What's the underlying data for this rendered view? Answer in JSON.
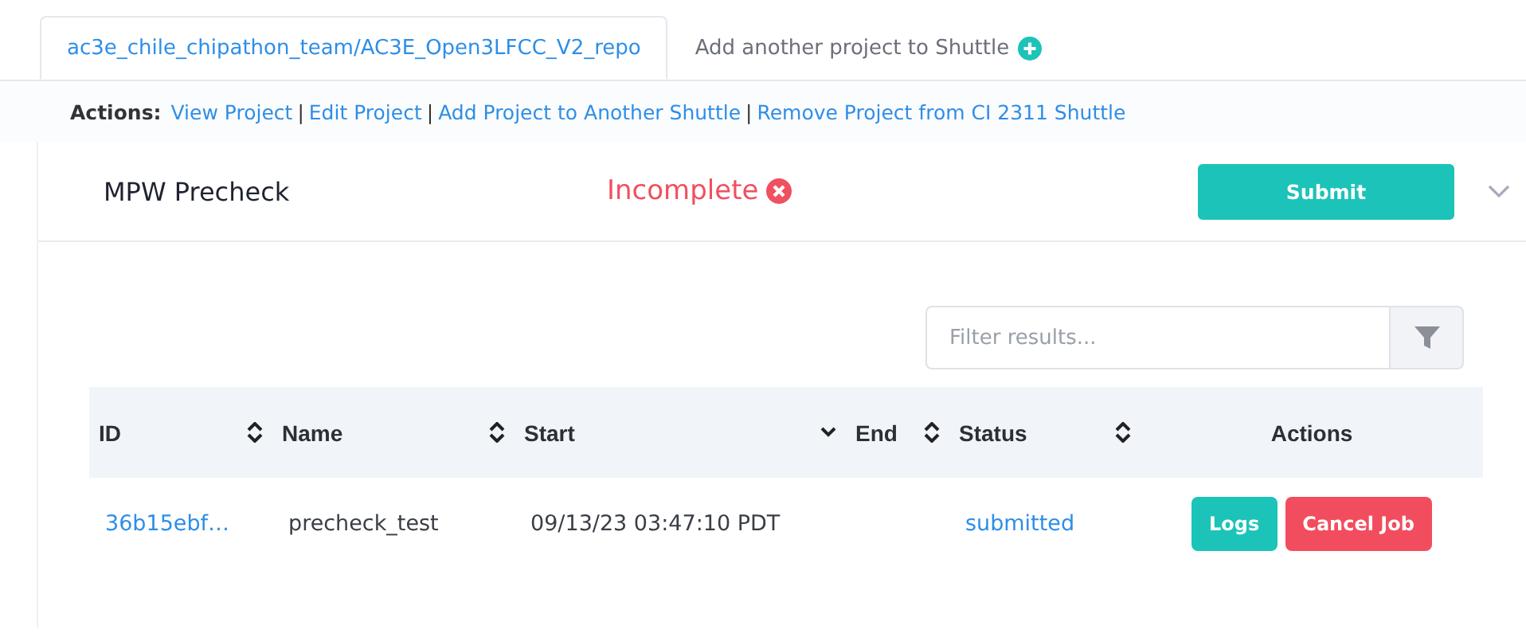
{
  "tabs": [
    {
      "label": "ac3e_chile_chipathon_team/AC3E_Open3LFCC_V2_repo",
      "selected": true,
      "kind": "project"
    },
    {
      "label": "Add another project to Shuttle",
      "selected": false,
      "kind": "add"
    }
  ],
  "actions": {
    "label": "Actions:",
    "separator": "|",
    "links": [
      "View Project",
      "Edit Project",
      "Add Project to Another Shuttle",
      "Remove Project from CI 2311 Shuttle"
    ]
  },
  "precheck": {
    "title": "MPW Precheck",
    "status": "Incomplete",
    "submit": "Submit",
    "expanded": false
  },
  "filter": {
    "placeholder": "Filter results..."
  },
  "table": {
    "columns": [
      {
        "label": "ID",
        "sortable": true,
        "sorted": false
      },
      {
        "label": "Name",
        "sortable": true,
        "sorted": false
      },
      {
        "label": "Start",
        "sortable": true,
        "sorted": true
      },
      {
        "label": "End",
        "sortable": true,
        "sorted": false
      },
      {
        "label": "Status",
        "sortable": true,
        "sorted": false
      },
      {
        "label": "Actions",
        "sortable": false
      }
    ],
    "rows": [
      {
        "id": "36b15ebf…",
        "name": "precheck_test",
        "start": "09/13/23 03:47:10 PDT",
        "status": "submitted",
        "buttons": [
          {
            "label": "Logs",
            "kind": "logs"
          },
          {
            "label": "Cancel Job",
            "kind": "cancel"
          }
        ]
      }
    ]
  }
}
